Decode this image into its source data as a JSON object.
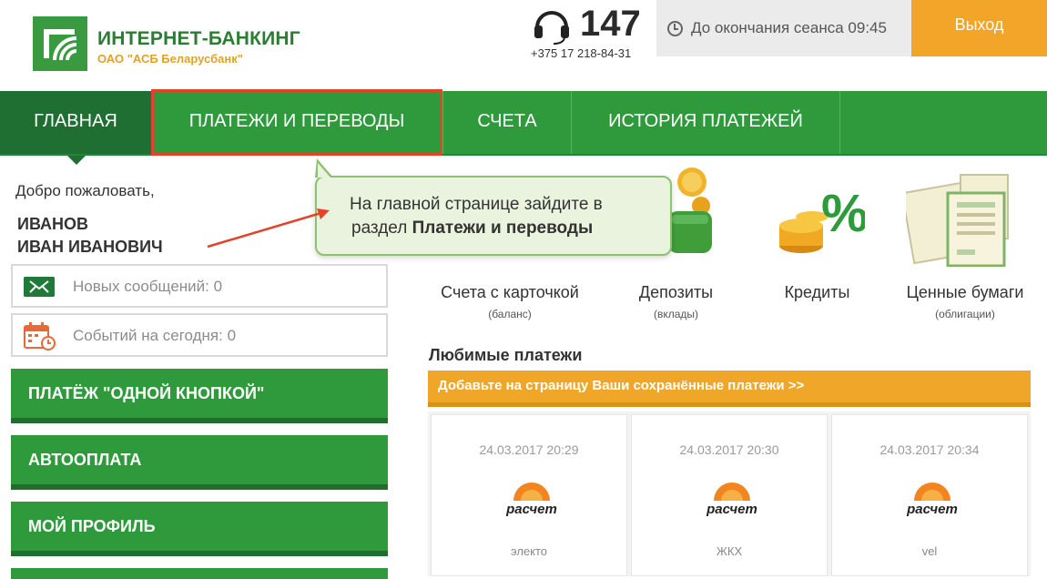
{
  "header": {
    "logo_title": "ИНТЕРНЕТ-БАНКИНГ",
    "logo_subtitle": "ОАО \"АСБ Беларусбанк\"",
    "hotline_number": "147",
    "phone": "+375 17 218-84-31",
    "session_text": "До окончания сеанса 09:45",
    "logout_label": "Выход"
  },
  "nav": {
    "items": [
      {
        "label": "ГЛАВНАЯ"
      },
      {
        "label": "ПЛАТЕЖИ И ПЕРЕВОДЫ"
      },
      {
        "label": "СЧЕТА"
      },
      {
        "label": "ИСТОРИЯ ПЛАТЕЖЕЙ"
      }
    ]
  },
  "sidebar": {
    "welcome": "Добро пожаловать,",
    "last_name": "ИВАНОВ",
    "first_names": "ИВАН ИВАНОВИЧ",
    "messages": "Новых сообщений: 0",
    "events": "Событий на сегодня: 0",
    "buttons": [
      {
        "label": "ПЛАТЁЖ \"ОДНОЙ КНОПКОЙ\""
      },
      {
        "label": "АВТООПЛАТА"
      },
      {
        "label": "МОЙ ПРОФИЛЬ"
      }
    ]
  },
  "callout": {
    "line1": "На главной странице зайдите в",
    "line2_prefix": "раздел ",
    "line2_bold": "Платежи и переводы"
  },
  "products": [
    {
      "label": "Счета с карточкой",
      "sub": "(баланс)"
    },
    {
      "label": "Депозиты",
      "sub": "(вклады)"
    },
    {
      "label": "Кредиты",
      "sub": ""
    },
    {
      "label": "Ценные бумаги",
      "sub": "(облигации)"
    }
  ],
  "favorites": {
    "title": "Любимые платежи",
    "add_bar": "Добавьте на страницу Ваши сохранённые платежи >>",
    "logo_text": "расчет",
    "cards": [
      {
        "date": "24.03.2017 20:29",
        "name": "электо"
      },
      {
        "date": "24.03.2017 20:30",
        "name": "ЖКХ"
      },
      {
        "date": "24.03.2017 20:34",
        "name": "vel"
      }
    ]
  },
  "colors": {
    "brand_green": "#2f9a3c",
    "nav_active": "#1f6f32",
    "accent_orange": "#f2a528",
    "highlight_red": "#e1442a"
  }
}
